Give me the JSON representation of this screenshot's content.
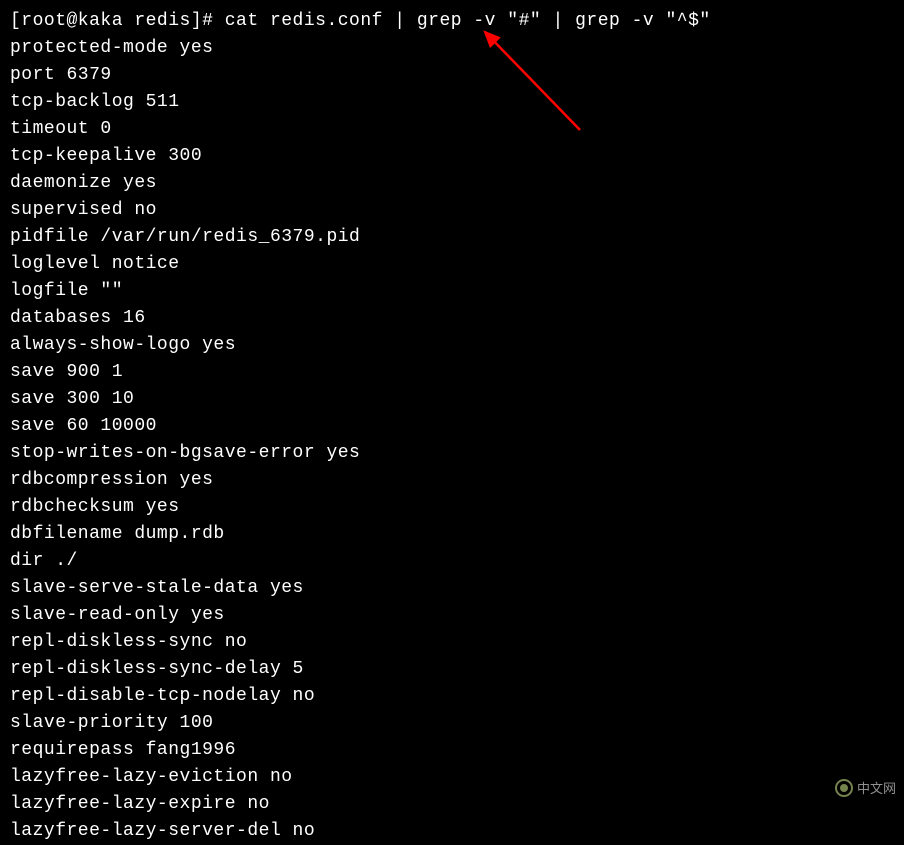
{
  "prompt": "[root@kaka redis]# cat redis.conf | grep -v \"#\" | grep -v \"^$\"",
  "output_lines": [
    "protected-mode yes",
    "port 6379",
    "tcp-backlog 511",
    "timeout 0",
    "tcp-keepalive 300",
    "daemonize yes",
    "supervised no",
    "pidfile /var/run/redis_6379.pid",
    "loglevel notice",
    "logfile \"\"",
    "databases 16",
    "always-show-logo yes",
    "save 900 1",
    "save 300 10",
    "save 60 10000",
    "stop-writes-on-bgsave-error yes",
    "rdbcompression yes",
    "rdbchecksum yes",
    "dbfilename dump.rdb",
    "dir ./",
    "slave-serve-stale-data yes",
    "slave-read-only yes",
    "repl-diskless-sync no",
    "repl-diskless-sync-delay 5",
    "repl-disable-tcp-nodelay no",
    "slave-priority 100",
    "requirepass fang1996",
    "lazyfree-lazy-eviction no",
    "lazyfree-lazy-expire no",
    "lazyfree-lazy-server-del no"
  ],
  "watermark_text": "中文网",
  "annotation_color": "#ff0000"
}
